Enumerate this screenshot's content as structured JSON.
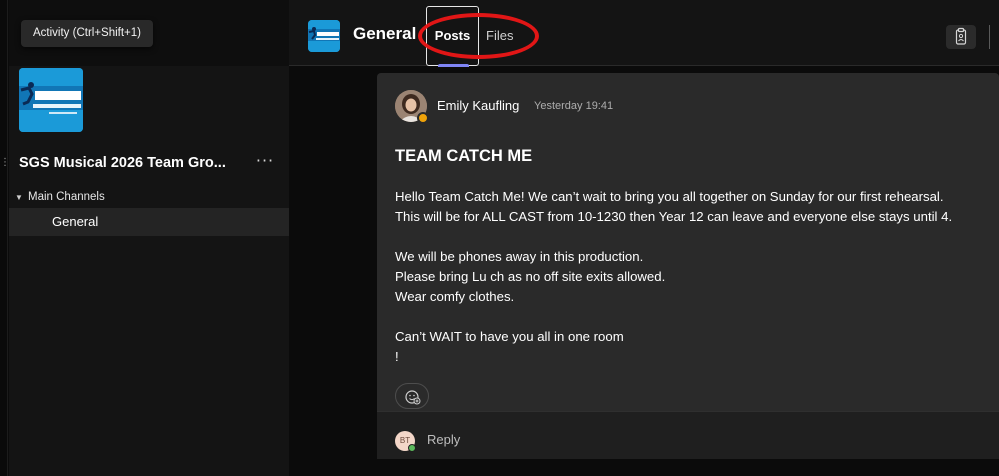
{
  "tooltip": {
    "text": "Activity (Ctrl+Shift+1)"
  },
  "team": {
    "name": "SGS Musical 2026 Team Gro...",
    "more_label": "···",
    "channel_group": "Main Channels",
    "channels": [
      {
        "label": "General",
        "selected": true
      }
    ]
  },
  "header": {
    "channel_title": "General",
    "tabs": [
      {
        "label": "Posts",
        "active": true
      },
      {
        "label": "Files",
        "active": false
      }
    ]
  },
  "post": {
    "author": "Emily Kaufling",
    "timestamp": "Yesterday 19:41",
    "subject": "TEAM CATCH ME",
    "body_lines": [
      "Hello Team Catch Me! We can’t wait to bring you all together on Sunday for our first rehearsal.",
      "This will be for ALL CAST from 10-1230 then Year 12 can leave and everyone else stays until 4.",
      "",
      "We will be phones away in this production.",
      "Please bring Lu ch as no off site exits allowed.",
      "Wear comfy clothes.",
      "",
      "Can’t WAIT to have you all in one room",
      "!"
    ]
  },
  "reply": {
    "avatar_initials": "BT",
    "label": "Reply"
  },
  "colors": {
    "accent": "#7f85f5",
    "annotation": "#e11616",
    "presence_away": "#f0a30a",
    "presence_available": "#5cb85c"
  }
}
